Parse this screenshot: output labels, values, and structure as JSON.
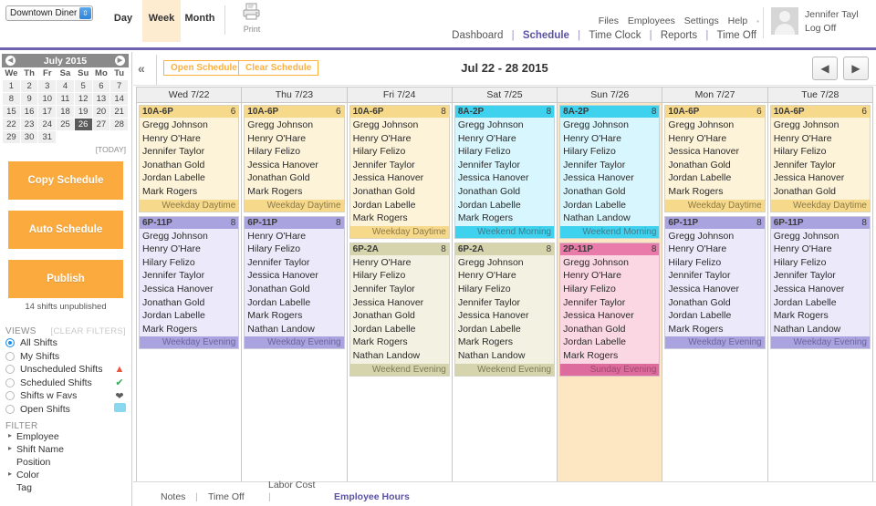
{
  "topbar": {
    "store_name": "Downtown Diner",
    "view_tabs": [
      {
        "label": "Day",
        "active": false
      },
      {
        "label": "Week",
        "active": true
      },
      {
        "label": "Month",
        "active": false
      }
    ],
    "print_label": "Print",
    "util_links": [
      "Files",
      "Employees",
      "Settings",
      "Help"
    ],
    "main_nav": [
      {
        "label": "Dashboard",
        "active": false
      },
      {
        "label": "Schedule",
        "active": true
      },
      {
        "label": "Time Clock",
        "active": false
      },
      {
        "label": "Reports",
        "active": false
      },
      {
        "label": "Time Off",
        "active": false
      }
    ],
    "user_name": "Jennifer Tayl",
    "logoff_label": "Log Off"
  },
  "sidebar": {
    "calendar": {
      "title": "July 2015",
      "prev_icon": "chevron-left-icon",
      "next_icon": "chevron-right-icon",
      "weekday_headers": [
        "We",
        "Th",
        "Fr",
        "Sa",
        "Su",
        "Mo",
        "Tu"
      ],
      "weeks": [
        [
          "1",
          "2",
          "3",
          "4",
          "5",
          "6",
          "7"
        ],
        [
          "8",
          "9",
          "10",
          "11",
          "12",
          "13",
          "14"
        ],
        [
          "15",
          "16",
          "17",
          "18",
          "19",
          "20",
          "21"
        ],
        [
          "22",
          "23",
          "24",
          "25",
          "26",
          "27",
          "28"
        ],
        [
          "29",
          "30",
          "31",
          "",
          "",
          "",
          ""
        ]
      ],
      "selected_day": "26",
      "today_label": "[TODAY]"
    },
    "actions": [
      {
        "label": "Copy Schedule"
      },
      {
        "label": "Auto Schedule"
      },
      {
        "label": "Publish"
      }
    ],
    "unpublished_note": "14 shifts unpublished",
    "views_heading": "VIEWS",
    "clear_filters_label": "[CLEAR FILTERS]",
    "views": [
      {
        "label": "All Shifts",
        "selected": true,
        "icon": ""
      },
      {
        "label": "My Shifts",
        "selected": false,
        "icon": ""
      },
      {
        "label": "Unscheduled Shifts",
        "selected": false,
        "icon": "warning-triangle-icon"
      },
      {
        "label": "Scheduled Shifts",
        "selected": false,
        "icon": "check-circle-icon"
      },
      {
        "label": "Shifts w Favs",
        "selected": false,
        "icon": "heart-icon"
      },
      {
        "label": "Open Shifts",
        "selected": false,
        "icon": "color-swatch-icon"
      }
    ],
    "filter_heading": "FILTER",
    "filters": [
      {
        "label": "Employee",
        "expandable": true
      },
      {
        "label": "Shift Name",
        "expandable": true
      },
      {
        "label": "Position",
        "expandable": false
      },
      {
        "label": "Color",
        "expandable": true
      },
      {
        "label": "Tag",
        "expandable": false
      }
    ]
  },
  "schedule": {
    "collapse_icon": "double-chevron-left-icon",
    "open_schedule_label": "Open Schedule",
    "clear_schedule_label": "Clear Schedule",
    "date_range": "Jul 22 - 28 2015",
    "prev_week_icon": "prev-arrow-icon",
    "next_week_icon": "next-arrow-icon",
    "days": [
      {
        "header": "Wed 7/22",
        "weekend_highlight": false,
        "shifts": [
          {
            "time": "10A-6P",
            "count": "6",
            "name": "Weekday Daytime",
            "head_bg": "#f7d98b",
            "body_bg": "#fdf3d8",
            "foot_bg": "#f7d98b",
            "foot_color": "#8a7a4a",
            "employees": [
              "Gregg Johnson",
              "Henry O'Hare",
              "Jennifer Taylor",
              "Jonathan Gold",
              "Jordan Labelle",
              "Mark Rogers"
            ]
          },
          {
            "time": "6P-11P",
            "count": "8",
            "name": "Weekday Evening",
            "head_bg": "#a9a3e0",
            "body_bg": "#eceafa",
            "foot_bg": "#a9a3e0",
            "foot_color": "#6b6599",
            "employees": [
              "Gregg Johnson",
              "Henry O'Hare",
              "Hilary Felizo",
              "Jennifer Taylor",
              "Jessica Hanover",
              "Jonathan Gold",
              "Jordan Labelle",
              "Mark Rogers"
            ]
          }
        ]
      },
      {
        "header": "Thu 7/23",
        "weekend_highlight": false,
        "shifts": [
          {
            "time": "10A-6P",
            "count": "6",
            "name": "Weekday Daytime",
            "head_bg": "#f7d98b",
            "body_bg": "#fdf3d8",
            "foot_bg": "#f7d98b",
            "foot_color": "#8a7a4a",
            "employees": [
              "Gregg Johnson",
              "Henry O'Hare",
              "Hilary Felizo",
              "Jessica Hanover",
              "Jonathan Gold",
              "Mark Rogers"
            ]
          },
          {
            "time": "6P-11P",
            "count": "8",
            "name": "Weekday Evening",
            "head_bg": "#a9a3e0",
            "body_bg": "#eceafa",
            "foot_bg": "#a9a3e0",
            "foot_color": "#6b6599",
            "employees": [
              "Henry O'Hare",
              "Hilary Felizo",
              "Jennifer Taylor",
              "Jessica Hanover",
              "Jonathan Gold",
              "Jordan Labelle",
              "Mark Rogers",
              "Nathan Landow"
            ]
          }
        ]
      },
      {
        "header": "Fri 7/24",
        "weekend_highlight": false,
        "shifts": [
          {
            "time": "10A-6P",
            "count": "8",
            "name": "Weekday Daytime",
            "head_bg": "#f7d98b",
            "body_bg": "#fdf3d8",
            "foot_bg": "#f7d98b",
            "foot_color": "#8a7a4a",
            "employees": [
              "Gregg Johnson",
              "Henry O'Hare",
              "Hilary Felizo",
              "Jennifer Taylor",
              "Jessica Hanover",
              "Jonathan Gold",
              "Jordan Labelle",
              "Mark Rogers"
            ]
          },
          {
            "time": "6P-2A",
            "count": "8",
            "name": "Weekend Evening",
            "head_bg": "#d5d4ad",
            "body_bg": "#f3f2e2",
            "foot_bg": "#d5d4ad",
            "foot_color": "#7c7b58",
            "employees": [
              "Henry O'Hare",
              "Hilary Felizo",
              "Jennifer Taylor",
              "Jessica Hanover",
              "Jonathan Gold",
              "Jordan Labelle",
              "Mark Rogers",
              "Nathan Landow"
            ]
          }
        ]
      },
      {
        "header": "Sat 7/25",
        "weekend_highlight": false,
        "shifts": [
          {
            "time": "8A-2P",
            "count": "8",
            "name": "Weekend Morning",
            "head_bg": "#3fd2ef",
            "body_bg": "#d8f6fd",
            "foot_bg": "#3fd2ef",
            "foot_color": "#3f7b8a",
            "employees": [
              "Gregg Johnson",
              "Henry O'Hare",
              "Hilary Felizo",
              "Jennifer Taylor",
              "Jessica Hanover",
              "Jonathan Gold",
              "Jordan Labelle",
              "Mark Rogers"
            ]
          },
          {
            "time": "6P-2A",
            "count": "8",
            "name": "Weekend Evening",
            "head_bg": "#d5d4ad",
            "body_bg": "#f3f2e2",
            "foot_bg": "#d5d4ad",
            "foot_color": "#7c7b58",
            "employees": [
              "Gregg Johnson",
              "Henry O'Hare",
              "Hilary Felizo",
              "Jennifer Taylor",
              "Jessica Hanover",
              "Jordan Labelle",
              "Mark Rogers",
              "Nathan Landow"
            ]
          }
        ]
      },
      {
        "header": "Sun 7/26",
        "weekend_highlight": true,
        "shifts": [
          {
            "time": "8A-2P",
            "count": "8",
            "name": "Weekend Morning",
            "head_bg": "#3fd2ef",
            "body_bg": "#d8f6fd",
            "foot_bg": "#3fd2ef",
            "foot_color": "#3f7b8a",
            "employees": [
              "Gregg Johnson",
              "Henry O'Hare",
              "Hilary Felizo",
              "Jennifer Taylor",
              "Jessica Hanover",
              "Jonathan Gold",
              "Jordan Labelle",
              "Nathan Landow"
            ]
          },
          {
            "time": "2P-11P",
            "count": "8",
            "name": "Sunday Evening",
            "head_bg": "#e87ba9",
            "body_bg": "#fbd6e3",
            "foot_bg": "#de6b9d",
            "foot_color": "#9c4a6d",
            "employees": [
              "Gregg Johnson",
              "Henry O'Hare",
              "Hilary Felizo",
              "Jennifer Taylor",
              "Jessica Hanover",
              "Jonathan Gold",
              "Jordan Labelle",
              "Mark Rogers"
            ]
          }
        ]
      },
      {
        "header": "Mon 7/27",
        "weekend_highlight": false,
        "shifts": [
          {
            "time": "10A-6P",
            "count": "6",
            "name": "Weekday Daytime",
            "head_bg": "#f7d98b",
            "body_bg": "#fdf3d8",
            "foot_bg": "#f7d98b",
            "foot_color": "#8a7a4a",
            "employees": [
              "Gregg Johnson",
              "Henry O'Hare",
              "Jessica Hanover",
              "Jonathan Gold",
              "Jordan Labelle",
              "Mark Rogers"
            ]
          },
          {
            "time": "6P-11P",
            "count": "8",
            "name": "Weekday Evening",
            "head_bg": "#a9a3e0",
            "body_bg": "#eceafa",
            "foot_bg": "#a9a3e0",
            "foot_color": "#6b6599",
            "employees": [
              "Gregg Johnson",
              "Henry O'Hare",
              "Hilary Felizo",
              "Jennifer Taylor",
              "Jessica Hanover",
              "Jonathan Gold",
              "Jordan Labelle",
              "Mark Rogers"
            ]
          }
        ]
      },
      {
        "header": "Tue 7/28",
        "weekend_highlight": false,
        "shifts": [
          {
            "time": "10A-6P",
            "count": "6",
            "name": "Weekday Daytime",
            "head_bg": "#f7d98b",
            "body_bg": "#fdf3d8",
            "foot_bg": "#f7d98b",
            "foot_color": "#8a7a4a",
            "employees": [
              "Gregg Johnson",
              "Henry O'Hare",
              "Hilary Felizo",
              "Jennifer Taylor",
              "Jessica Hanover",
              "Jonathan Gold"
            ]
          },
          {
            "time": "6P-11P",
            "count": "8",
            "name": "Weekday Evening",
            "head_bg": "#a9a3e0",
            "body_bg": "#eceafa",
            "foot_bg": "#a9a3e0",
            "foot_color": "#6b6599",
            "employees": [
              "Gregg Johnson",
              "Henry O'Hare",
              "Hilary Felizo",
              "Jennifer Taylor",
              "Jessica Hanover",
              "Jordan Labelle",
              "Mark Rogers",
              "Nathan Landow"
            ]
          }
        ]
      }
    ]
  },
  "bottom_bar": {
    "notes_label": "Notes",
    "time_off_label": "Time Off",
    "labor_cost_label": "Labor Cost",
    "employee_hours_label": "Employee Hours",
    "separator": "|"
  }
}
